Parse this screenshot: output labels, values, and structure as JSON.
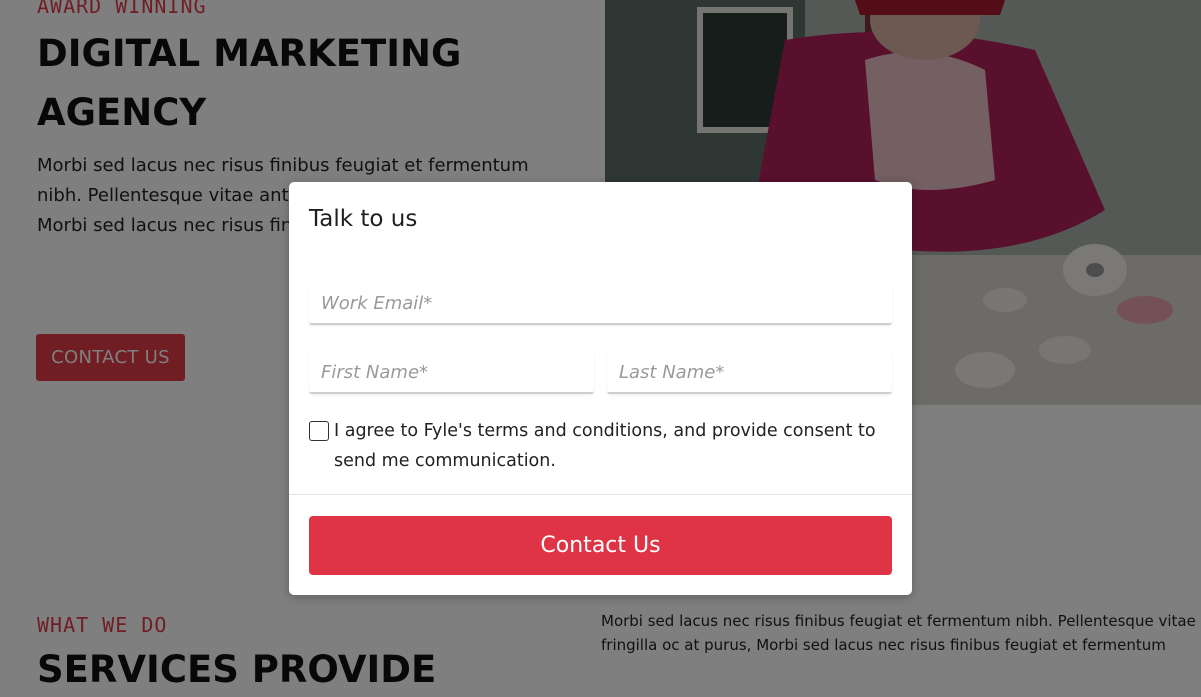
{
  "hero": {
    "eyebrow": "AWARD WINNING",
    "title": "DIGITAL MARKETING AGENCY",
    "description": "Morbi sed lacus nec risus finibus feugiat et fermentum nibh. Pellentesque vitae ante fringilla oc at purus, Morbi sed lacus nec risus finibus feugiat et fermentum",
    "cta_label": "CONTACT US"
  },
  "services": {
    "eyebrow": "WHAT WE DO",
    "title": "SERVICES PROVIDE",
    "description": "Morbi sed lacus nec risus finibus feugiat et fermentum nibh. Pellentesque vitae ante\nfringilla oc at purus, Morbi sed lacus nec risus finibus feugiat et fermentum"
  },
  "modal": {
    "title": "Talk to us",
    "email_placeholder": "Work Email*",
    "first_name_placeholder": "First Name*",
    "last_name_placeholder": "Last Name*",
    "consent_text": "I agree to Fyle's terms and conditions, and provide consent to send me communication.",
    "submit_label": "Contact Us"
  },
  "colors": {
    "accent": "#df3445",
    "backdrop": "rgba(0,0,0,0.5)"
  }
}
